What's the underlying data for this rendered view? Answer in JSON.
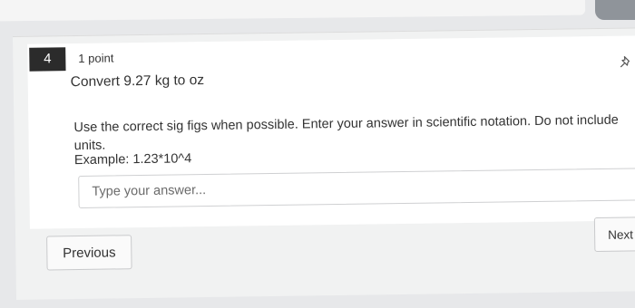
{
  "question": {
    "number": "4",
    "points": "1 point",
    "prompt": "Convert 9.27 kg to oz",
    "instructions": "Use the correct sig figs when possible. Enter your answer in scientific notation. Do not include units.",
    "example": "Example: 1.23*10^4",
    "pin_icon": "pin-icon"
  },
  "answer": {
    "placeholder": "Type your answer...",
    "value": ""
  },
  "navigation": {
    "previous_label": "Previous",
    "next_label": "Next"
  }
}
